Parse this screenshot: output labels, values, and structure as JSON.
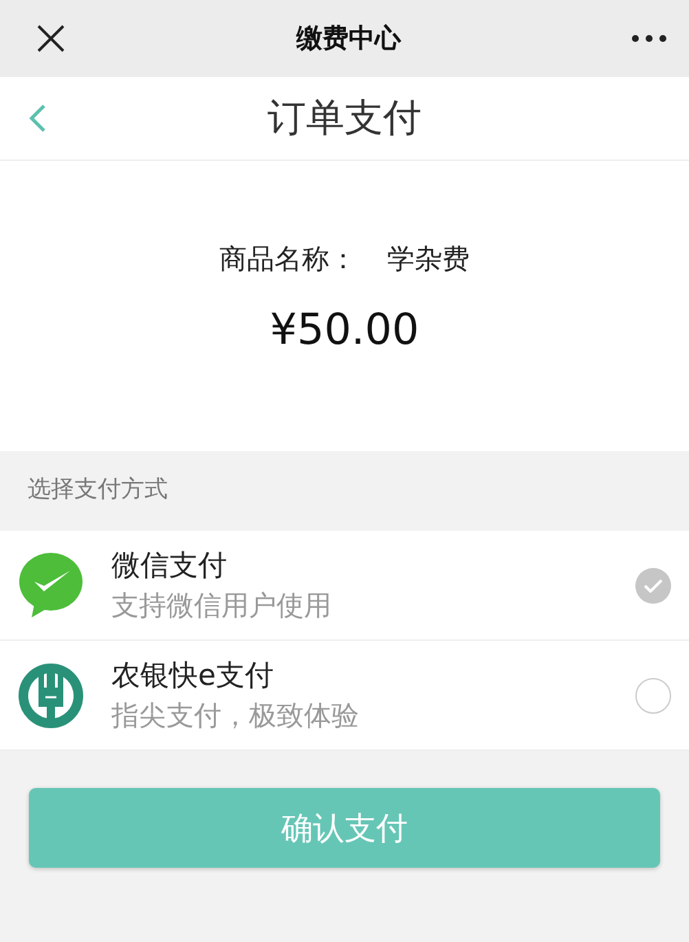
{
  "top_bar": {
    "title": "缴费中心"
  },
  "header": {
    "title": "订单支付"
  },
  "product": {
    "label": "商品名称：",
    "name": "学杂费",
    "price": "¥50.00"
  },
  "section_label": "选择支付方式",
  "payment_methods": [
    {
      "kind": "wechat",
      "name": "微信支付",
      "description": "支持微信用户使用",
      "selected": true
    },
    {
      "kind": "bank",
      "name": "农银快e支付",
      "description": "指尖支付，极致体验",
      "selected": false
    }
  ],
  "confirm_button": "确认支付"
}
